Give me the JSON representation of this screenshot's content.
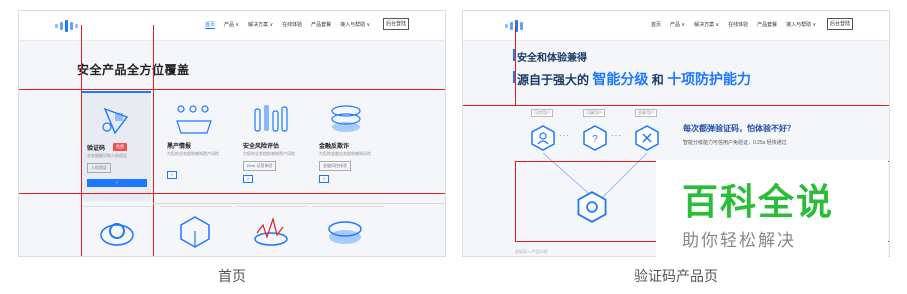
{
  "captions": {
    "left": "首页",
    "right": "验证码产品页"
  },
  "left_panel": {
    "nav": {
      "items": [
        "首页",
        "产品 ∨",
        "解决方案 ∨",
        "在线体验",
        "产品套餐",
        "接入与帮助 ∨"
      ],
      "button": "后台登陆"
    },
    "section_title": "安全产品全方位覆盖",
    "cards": [
      {
        "name": "验证码",
        "badge": "免费",
        "desc": "业务智能识别人机验证",
        "tag": "人机验证",
        "cta": "›"
      },
      {
        "name": "黑产情报",
        "desc": "为您的业务提前感知黑产风险",
        "tag": "Beta 试用体验",
        "cta": "›"
      },
      {
        "name": "安全风险评估",
        "desc": "为您的业务提前感知黑产风险",
        "tag": "Beta 试用体验",
        "cta": "›"
      },
      {
        "name": "金融反欺诈",
        "desc": "为您的金融业务提前感知风险",
        "tag": "金融风控体验",
        "cta": "›"
      }
    ]
  },
  "right_panel": {
    "nav": {
      "items": [
        "首页",
        "产品 ∨",
        "解决方案 ∨",
        "在线体验",
        "产品套餐",
        "接入与帮助 ∨"
      ],
      "button": "后台登陆"
    },
    "headline1": "安全和体验兼得",
    "headline2_prefix": "源自于强大的",
    "headline2_accent1": "智能分级",
    "headline2_mid": "和",
    "headline2_accent2": "十项防护能力",
    "hex_labels": [
      "可信用户",
      "可疑用户",
      "恶意用户"
    ],
    "question": "每次都弹验证码，怕体验不好？",
    "answer": "智能分级能力可信用户免验证，0.25s 轻快通过",
    "footer_note": "验证码 > 产品介绍"
  },
  "watermark": {
    "main": "百科全说",
    "sub": "助你轻松解决"
  },
  "colors": {
    "accent": "#1e78ff",
    "overlay_red": "#e02020",
    "watermark_green": "#2bbd3a"
  }
}
